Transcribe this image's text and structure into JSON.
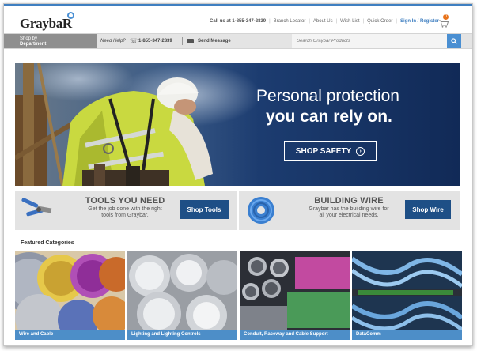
{
  "brand": {
    "logo_text": "GraybaR"
  },
  "utility_nav": {
    "call_us": "Call us at 1-855-347-2839",
    "items": [
      "Branch Locator",
      "About Us",
      "Wish List",
      "Quick Order"
    ],
    "sign_in": "Sign In / Register",
    "cart_count": "0"
  },
  "nav": {
    "shop_by": "Shop by",
    "department": "Department",
    "need_help": "Need Help?",
    "phone": "1-855-347-2839",
    "send_message": "Send Message",
    "search_placeholder": "Search Graybar Products"
  },
  "hero": {
    "line1": "Personal protection",
    "line2": "you can rely on.",
    "button": "SHOP SAFETY"
  },
  "promos": [
    {
      "title": "TOOLS YOU NEED",
      "desc_line1": "Get the job done with the right",
      "desc_line2": "tools from Graybar.",
      "button": "Shop Tools"
    },
    {
      "title": "BUILDING WIRE",
      "desc_line1": "Graybar has the building wire for",
      "desc_line2": "all your electrical needs.",
      "button": "Shop Wire"
    }
  ],
  "featured": {
    "label": "Featured Categories",
    "tiles": [
      {
        "caption": "Wire and Cable"
      },
      {
        "caption": "Lighting and Lighting Controls"
      },
      {
        "caption": "Conduit, Raceway and Cable Support"
      },
      {
        "caption": "DataComm"
      }
    ]
  },
  "colors": {
    "accent": "#3f7fc1",
    "button_dark": "#1e4f86",
    "caption_blue": "#4d8ec8",
    "hero_bg": "#14305f"
  },
  "icons": {
    "search": "search-icon",
    "cart": "cart-icon",
    "phone": "phone-icon",
    "mail": "mail-icon",
    "arrow": "arrow-circle-icon"
  }
}
